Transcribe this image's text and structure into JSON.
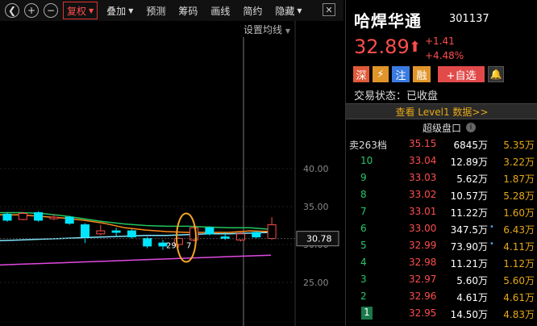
{
  "toolbar": {
    "items": [
      "复权",
      "叠加",
      "预测",
      "筹码",
      "画线",
      "简约",
      "隐藏"
    ],
    "close": "✕"
  },
  "chart": {
    "settings_label": "设置均线",
    "price_labels": [
      "40.00",
      "35.00",
      "30.00",
      "25.00"
    ],
    "current_price": "30.78",
    "min_label": "29",
    "max_label": "7"
  },
  "stock": {
    "name": "哈焊华通",
    "code": "301137",
    "price": "32.89",
    "arrow": "⬆",
    "change": "+1.41",
    "change_pct": "+4.48%",
    "tags": {
      "shen": "深",
      "flash": "⚡",
      "zhu": "注",
      "rong": "融",
      "add": "+自选"
    },
    "status": "交易状态：已收盘",
    "level1": "查看 Level1 数据>>",
    "super_label": "超级盘口",
    "sell_label": "卖263档",
    "sell_price": "35.15",
    "sell_vol": "6845万",
    "sell_amt": "5.35万"
  },
  "order_rows": [
    {
      "num": "10",
      "price": "33.04",
      "vol": "12.89万",
      "dot": "",
      "amt": "3.22万"
    },
    {
      "num": "9",
      "price": "33.03",
      "vol": "5.62万",
      "dot": "",
      "amt": "1.87万"
    },
    {
      "num": "8",
      "price": "33.02",
      "vol": "10.57万",
      "dot": "",
      "amt": "5.28万"
    },
    {
      "num": "7",
      "price": "33.01",
      "vol": "11.22万",
      "dot": "",
      "amt": "1.60万"
    },
    {
      "num": "6",
      "price": "33.00",
      "vol": "347.5万",
      "dot": "•",
      "amt": "6.43万"
    },
    {
      "num": "5",
      "price": "32.99",
      "vol": "73.90万",
      "dot": "•",
      "amt": "4.11万"
    },
    {
      "num": "4",
      "price": "32.98",
      "vol": "11.21万",
      "dot": "",
      "amt": "1.12万"
    },
    {
      "num": "3",
      "price": "32.97",
      "vol": "5.60万",
      "dot": "",
      "amt": "5.60万"
    },
    {
      "num": "2",
      "price": "32.96",
      "vol": "4.61万",
      "dot": "",
      "amt": "4.61万"
    },
    {
      "num": "1",
      "price": "32.95",
      "vol": "14.50万",
      "dot": "",
      "amt": "4.83万"
    }
  ],
  "candles": [
    {
      "o": 34.0,
      "c": 33.2,
      "h": 34.2,
      "l": 33.0
    },
    {
      "o": 33.3,
      "c": 34.1,
      "h": 34.3,
      "l": 33.2
    },
    {
      "o": 34.2,
      "c": 33.2,
      "h": 34.4,
      "l": 33.0
    },
    {
      "o": 33.4,
      "c": 33.6,
      "h": 34.0,
      "l": 33.2
    },
    {
      "o": 33.6,
      "c": 32.8,
      "h": 33.8,
      "l": 32.6
    },
    {
      "o": 32.6,
      "c": 31.0,
      "h": 32.8,
      "l": 30.2
    },
    {
      "o": 31.4,
      "c": 31.8,
      "h": 32.6,
      "l": 31.2
    },
    {
      "o": 31.8,
      "c": 31.6,
      "h": 32.2,
      "l": 31.0
    },
    {
      "o": 31.8,
      "c": 31.0,
      "h": 32.0,
      "l": 30.8
    },
    {
      "o": 30.8,
      "c": 29.8,
      "h": 31.0,
      "l": 29.5
    },
    {
      "o": 30.2,
      "c": 29.8,
      "h": 30.6,
      "l": 29.3
    },
    {
      "o": 30.0,
      "c": 30.8,
      "h": 31.0,
      "l": 29.6
    },
    {
      "o": 30.6,
      "c": 32.2,
      "h": 33.0,
      "l": 30.4
    },
    {
      "o": 32.2,
      "c": 31.4,
      "h": 32.4,
      "l": 31.2
    },
    {
      "o": 31.0,
      "c": 30.8,
      "h": 31.6,
      "l": 30.6
    },
    {
      "o": 30.6,
      "c": 31.4,
      "h": 31.8,
      "l": 30.4
    },
    {
      "o": 31.6,
      "c": 31.0,
      "h": 31.8,
      "l": 30.8
    },
    {
      "o": 30.8,
      "c": 32.6,
      "h": 33.6,
      "l": 30.6
    }
  ],
  "colors": {
    "up": "#ff4d4d",
    "down": "#00e5ff",
    "ma_orange": "#ff8c1a",
    "ma_green": "#22c55e",
    "ma_cyan": "#7fe6ff",
    "ma_magenta": "#e04ae0"
  }
}
